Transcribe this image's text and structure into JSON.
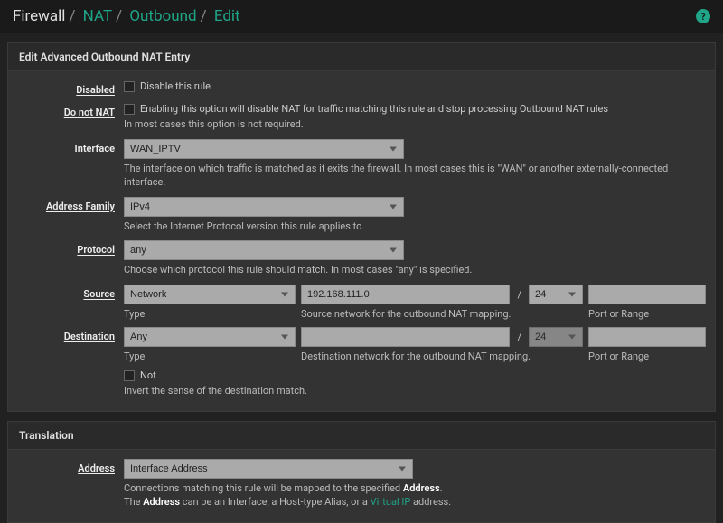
{
  "breadcrumb": {
    "a": "Firewall",
    "b": "NAT",
    "c": "Outbound",
    "d": "Edit"
  },
  "panel1_title": "Edit Advanced Outbound NAT Entry",
  "disabled": {
    "label": "Disabled",
    "chk": "Disable this rule"
  },
  "donotnat": {
    "label": "Do not NAT",
    "chk": "Enabling this option will disable NAT for traffic matching this rule and stop processing Outbound NAT rules",
    "help": "In most cases this option is not required."
  },
  "interface": {
    "label": "Interface",
    "value": "WAN_IPTV",
    "help": "The interface on which traffic is matched as it exits the firewall. In most cases this is \"WAN\" or another externally-connected interface."
  },
  "afam": {
    "label": "Address Family",
    "value": "IPv4",
    "help": "Select the Internet Protocol version this rule applies to."
  },
  "protocol": {
    "label": "Protocol",
    "value": "any",
    "help": "Choose which protocol this rule should match. In most cases \"any\" is specified."
  },
  "source": {
    "label": "Source",
    "type": "Network",
    "net": "192.168.111.0",
    "mask": "24",
    "type_sub": "Type",
    "net_sub": "Source network for the outbound NAT mapping.",
    "port_sub": "Port or Range"
  },
  "dest": {
    "label": "Destination",
    "type": "Any",
    "net": "",
    "mask": "24",
    "type_sub": "Type",
    "net_sub": "Destination network for the outbound NAT mapping.",
    "port_sub": "Port or Range"
  },
  "not": {
    "chk": "Not",
    "help": "Invert the sense of the destination match."
  },
  "panel2_title": "Translation",
  "trans_addr": {
    "label": "Address",
    "value": "Interface Address",
    "help1": "Connections matching this rule will be mapped to the specified ",
    "bold1": "Address",
    "help1b": ".",
    "help2a": "The ",
    "bold2": "Address",
    "help2b": " can be an Interface, a Host-type Alias, or a ",
    "vip": "Virtual IP",
    "help2c": " address."
  }
}
